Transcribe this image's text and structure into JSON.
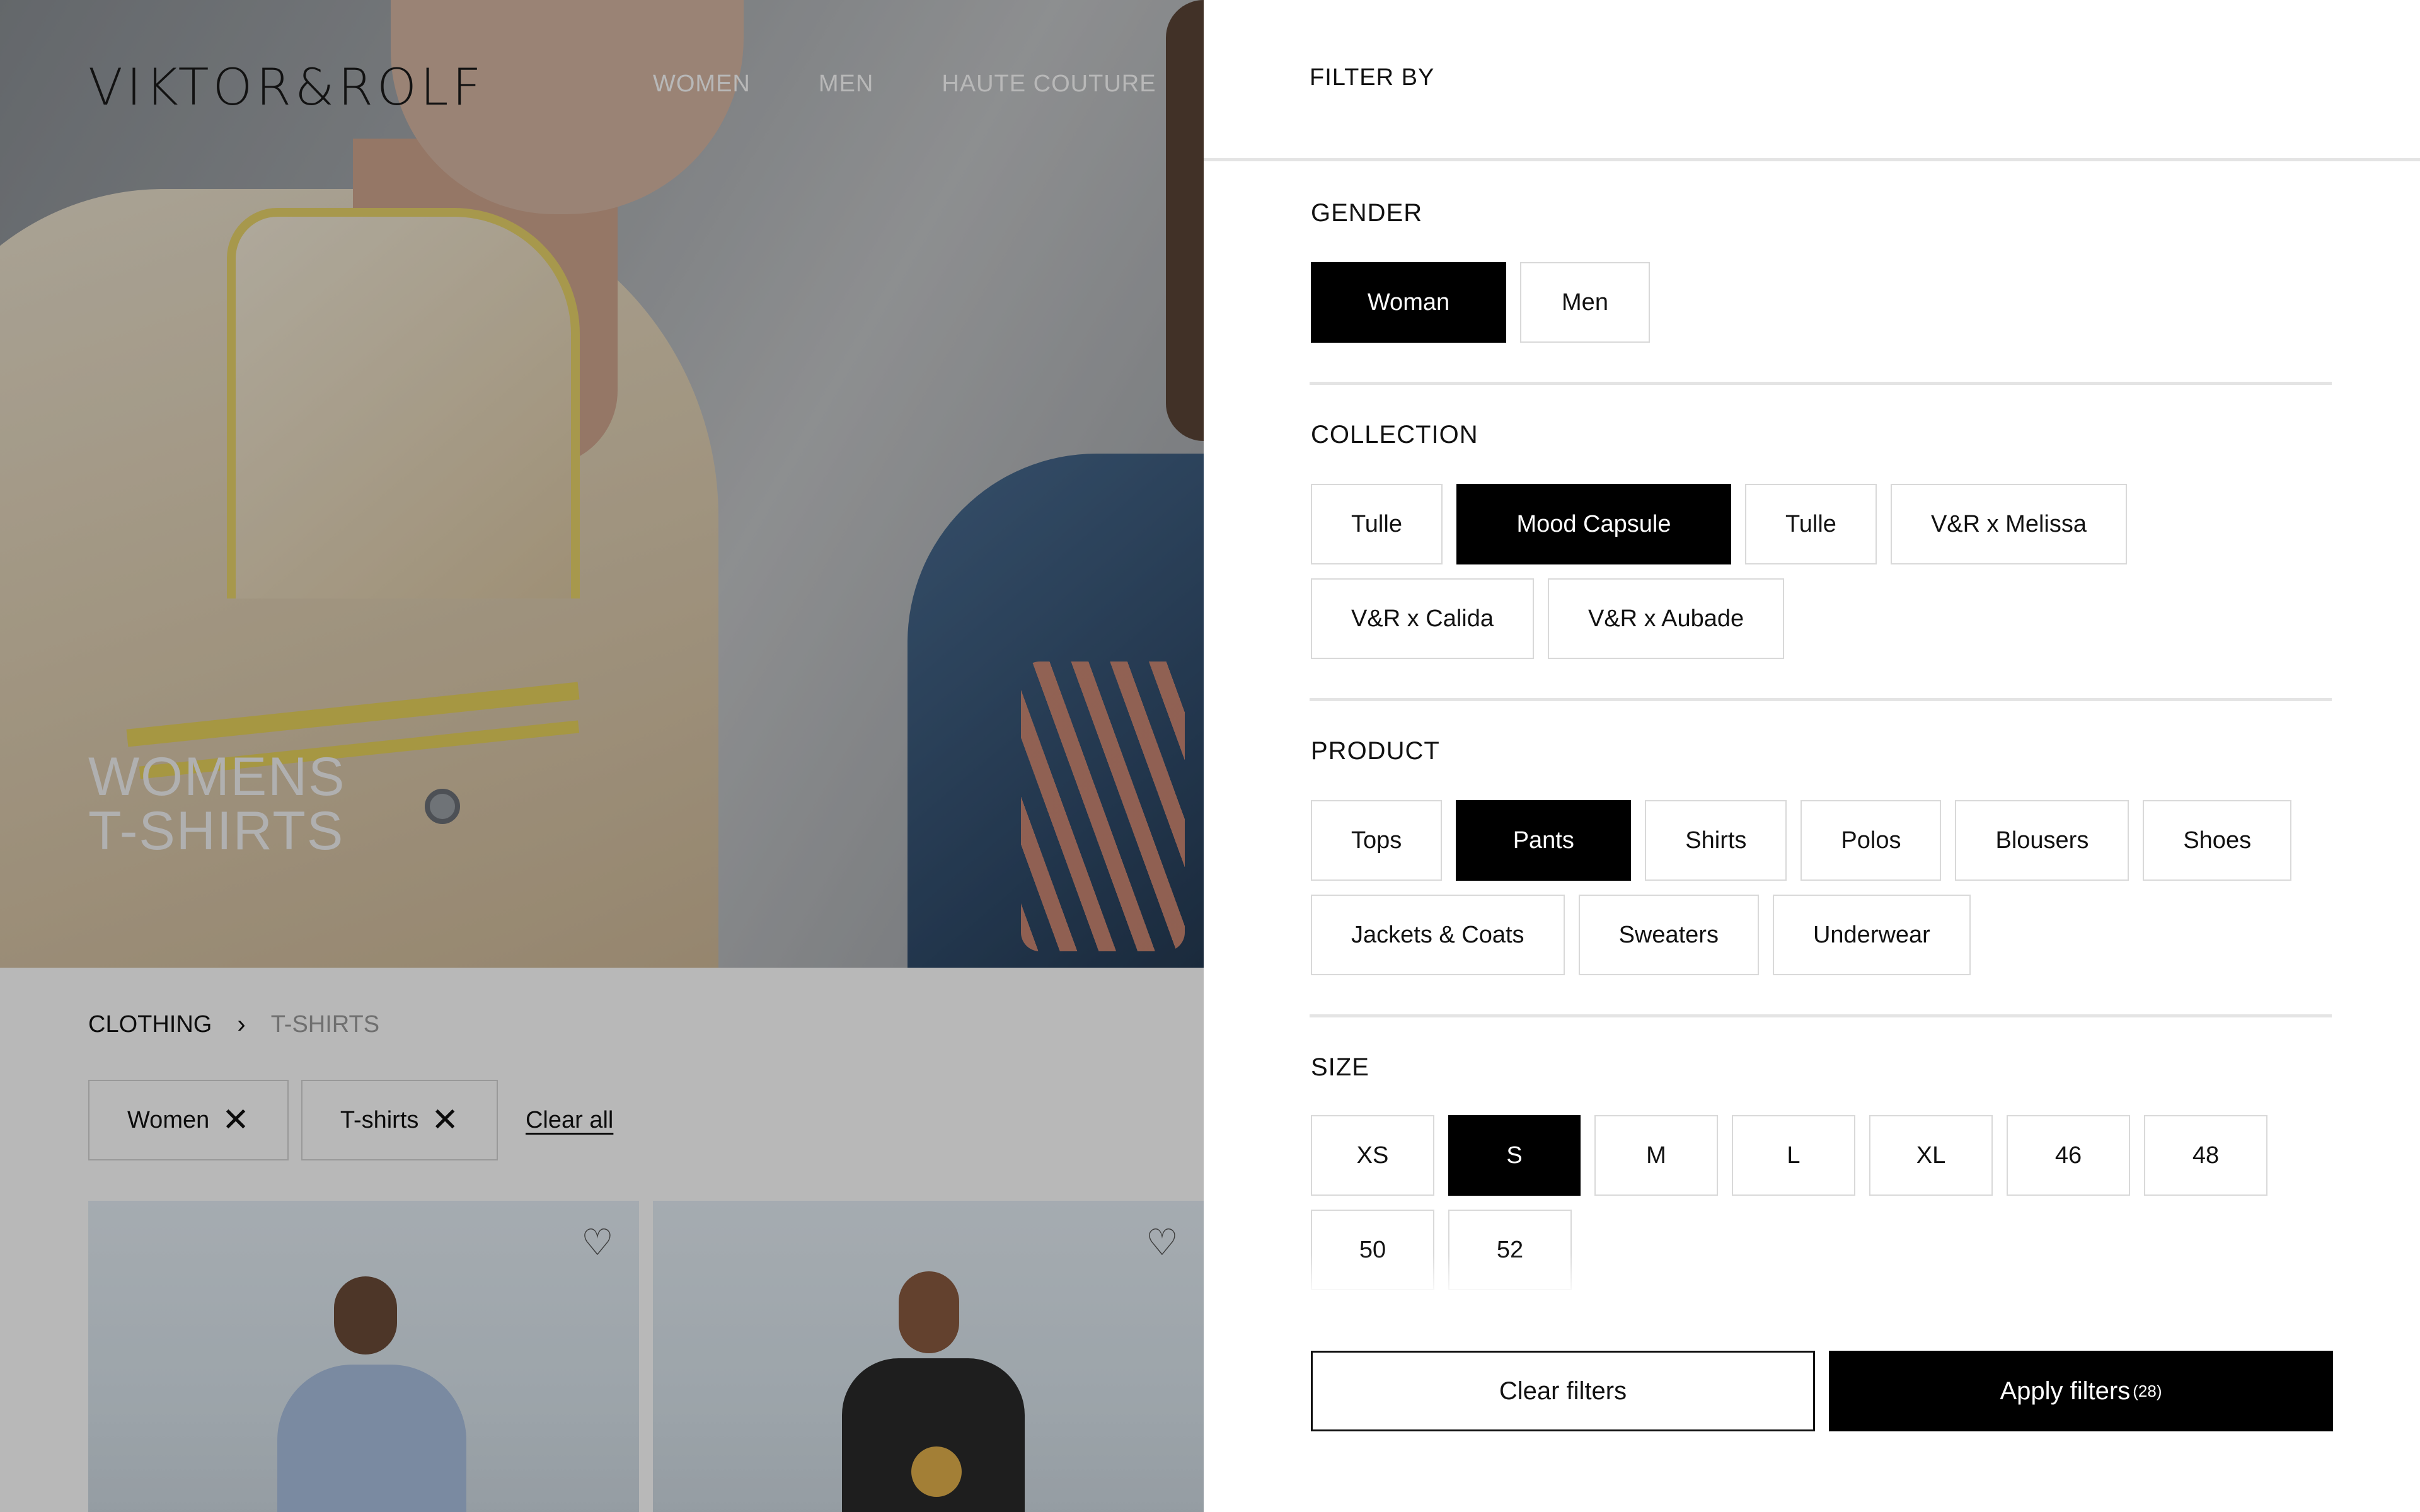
{
  "brand": {
    "logo_text": "VIKTOR&ROLF"
  },
  "nav": {
    "items": [
      "WOMEN",
      "MEN",
      "HAUTE COUTURE"
    ]
  },
  "hero": {
    "title_line1": "WOMENS",
    "title_line2": "T-SHIRTS"
  },
  "breadcrumb": {
    "level1": "CLOTHING",
    "separator": "›",
    "level2": "T-SHIRTS"
  },
  "active_filters": {
    "chips": [
      {
        "label": "Women",
        "remove_icon": "close-icon"
      },
      {
        "label": "T-shirts",
        "remove_icon": "close-icon"
      }
    ],
    "clear_all": "Clear all"
  },
  "products": [
    {
      "wishlist_icon": "heart-icon"
    },
    {
      "wishlist_icon": "heart-icon"
    }
  ],
  "filter_panel": {
    "title": "FILTER BY",
    "gender": {
      "title": "GENDER",
      "options": [
        "Woman",
        "Men"
      ],
      "selected": "Woman"
    },
    "collection": {
      "title": "COLLECTION",
      "options": [
        "Tulle",
        "Mood Capsule",
        "Tulle",
        "V&R x Melissa",
        "V&R x Calida",
        "V&R x Aubade"
      ],
      "selected": "Mood Capsule"
    },
    "product": {
      "title": "PRODUCT",
      "options": [
        "Tops",
        "Pants",
        "Shirts",
        "Polos",
        "Blousers",
        "Shoes",
        "Jackets & Coats",
        "Sweaters",
        "Underwear"
      ],
      "selected": "Pants"
    },
    "size": {
      "title": "SIZE",
      "options": [
        "XS",
        "S",
        "M",
        "L",
        "XL",
        "46",
        "48",
        "50",
        "52"
      ],
      "selected": "S"
    },
    "clear_filters": "Clear filters",
    "apply_filters": "Apply filters",
    "apply_count": "(28)"
  },
  "colors": {
    "selected_bg": "#000000",
    "overlay": "rgba(0,0,0,0.28)",
    "accent_yellow": "#e6d15c"
  }
}
